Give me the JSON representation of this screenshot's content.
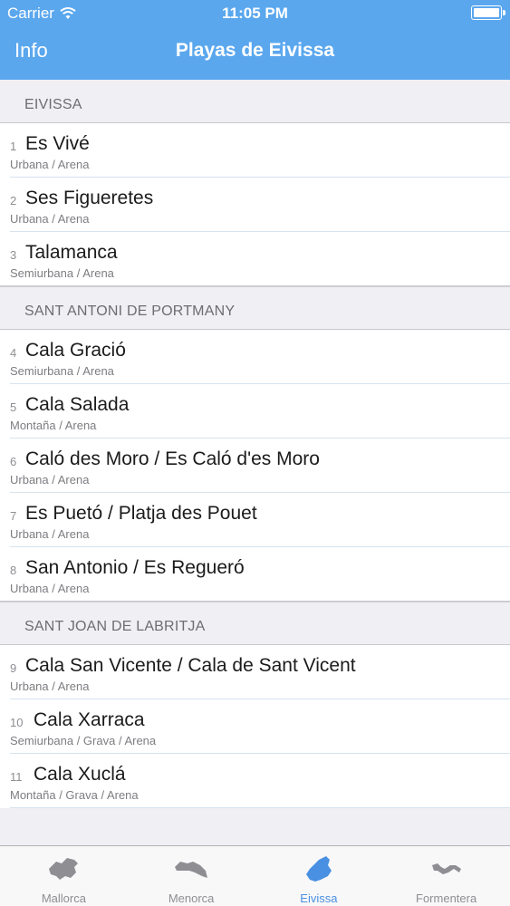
{
  "status": {
    "carrier": "Carrier",
    "time": "11:05 PM"
  },
  "nav": {
    "back_label": "Info",
    "title": "Playas de Eivissa"
  },
  "sections": [
    {
      "title": "EIVISSA",
      "rows": [
        {
          "num": "1",
          "name": "Es Vivé",
          "desc": "Urbana / Arena"
        },
        {
          "num": "2",
          "name": "Ses Figueretes",
          "desc": "Urbana / Arena"
        },
        {
          "num": "3",
          "name": "Talamanca",
          "desc": "Semiurbana / Arena"
        }
      ]
    },
    {
      "title": "SANT ANTONI DE PORTMANY",
      "rows": [
        {
          "num": "4",
          "name": "Cala Gració",
          "desc": "Semiurbana / Arena"
        },
        {
          "num": "5",
          "name": "Cala Salada",
          "desc": "Montaña / Arena"
        },
        {
          "num": "6",
          "name": "Caló des Moro / Es Caló d'es Moro",
          "desc": "Urbana / Arena"
        },
        {
          "num": "7",
          "name": "Es Puetó / Platja des Pouet",
          "desc": "Urbana / Arena"
        },
        {
          "num": "8",
          "name": "San Antonio / Es Regueró",
          "desc": "Urbana / Arena"
        }
      ]
    },
    {
      "title": "SANT JOAN DE LABRITJA",
      "rows": [
        {
          "num": "9",
          "name": "Cala San Vicente / Cala de Sant Vicent",
          "desc": "Urbana / Arena"
        },
        {
          "num": "10",
          "name": "Cala Xarraca",
          "desc": "Semiurbana / Grava / Arena"
        },
        {
          "num": "11",
          "name": "Cala Xuclá",
          "desc": "Montaña / Grava / Arena"
        }
      ]
    }
  ],
  "tabs": [
    {
      "label": "Mallorca",
      "icon": "mallorca-island-icon"
    },
    {
      "label": "Menorca",
      "icon": "menorca-island-icon"
    },
    {
      "label": "Eivissa",
      "icon": "eivissa-island-icon",
      "active": true
    },
    {
      "label": "Formentera",
      "icon": "formentera-island-icon"
    }
  ],
  "colors": {
    "accent": "#5aa7ee",
    "active_tab": "#4a90e2",
    "inactive_tab": "#8e8e93"
  }
}
